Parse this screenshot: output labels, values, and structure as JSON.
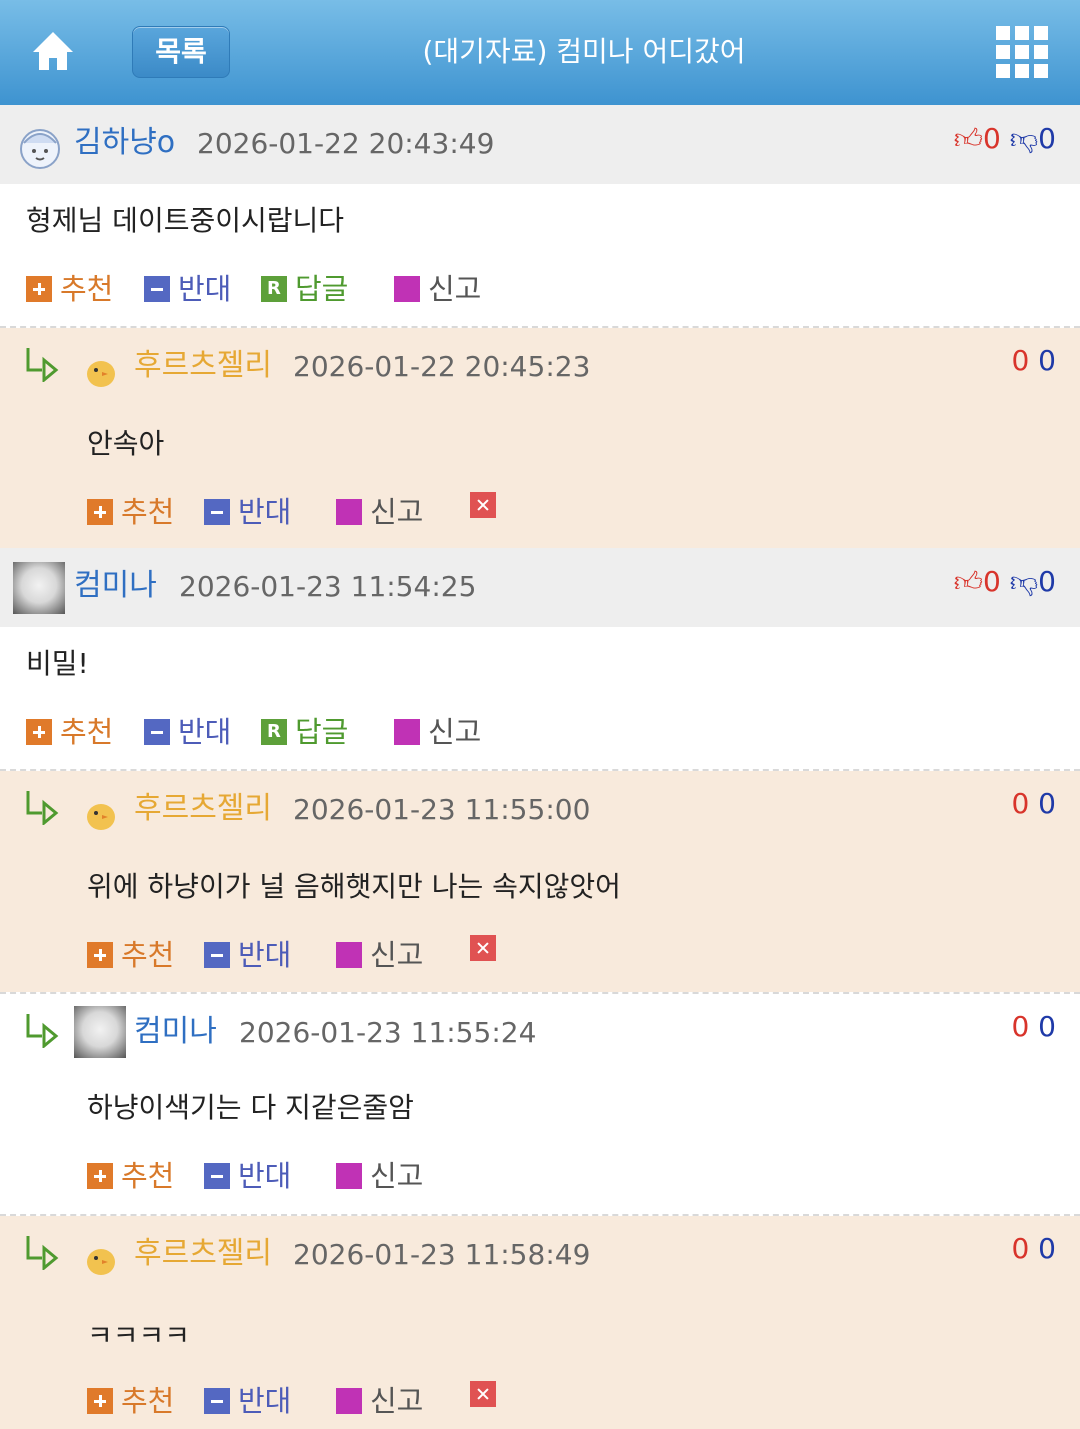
{
  "header": {
    "list_label": "목록",
    "title": "(대기자료) 컴미나 어디갔어"
  },
  "icons": {
    "home": "home-icon",
    "menu": "grid-menu-icon",
    "reply": "reply-arrow-icon"
  },
  "comments": [
    {
      "nick": "김하냥o",
      "date": "2026-01-22 20:43:49",
      "up": "0",
      "down": "0",
      "text": "형제님 데이트중이시랍니다"
    },
    {
      "nick": "후르츠젤리",
      "date": "2026-01-22 20:45:23",
      "up": "0",
      "down": "0",
      "text": "안속아"
    },
    {
      "nick": "컴미나",
      "date": "2026-01-23 11:54:25",
      "up": "0",
      "down": "0",
      "text": "비밀!"
    },
    {
      "nick": "후르츠젤리",
      "date": "2026-01-23 11:55:00",
      "up": "0",
      "down": "0",
      "text": "위에 하냥이가 널 음해햇지만 나는 속지않앗어"
    },
    {
      "nick": "컴미나",
      "date": "2026-01-23 11:55:24",
      "up": "0",
      "down": "0",
      "text": "하냥이색기는 다 지같은줄암"
    },
    {
      "nick": "후르츠젤리",
      "date": "2026-01-23 11:58:49",
      "up": "0",
      "down": "0",
      "text": "ㅋㅋㅋㅋ"
    }
  ],
  "actions": {
    "recommend": "추천",
    "oppose": "반대",
    "reply": "답글",
    "report": "신고"
  }
}
